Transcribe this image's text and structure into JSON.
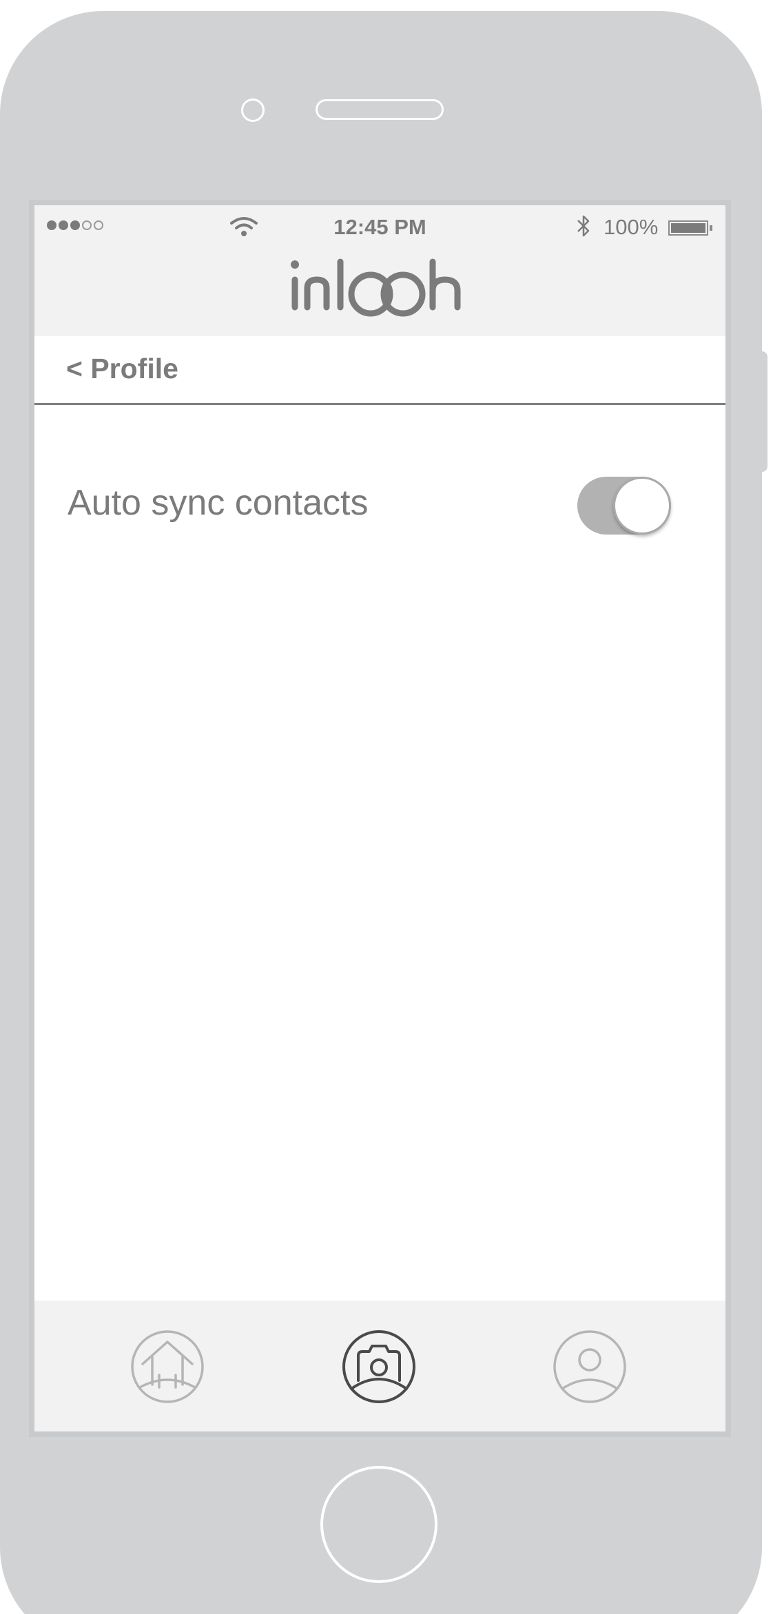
{
  "status_bar": {
    "signal_dots_filled": 3,
    "signal_dots_total": 5,
    "time": "12:45 PM",
    "battery_percent": "100%",
    "icons": [
      "signal-dots-icon",
      "wifi-icon",
      "bluetooth-icon",
      "battery-icon"
    ]
  },
  "header": {
    "logo_text": "inlooh"
  },
  "nav": {
    "back_label": "< Profile"
  },
  "settings": {
    "items": [
      {
        "label": "Auto sync contacts",
        "enabled": true
      }
    ]
  },
  "tab_bar": {
    "items": [
      {
        "icon": "home-icon",
        "active": false
      },
      {
        "icon": "camera-person-icon",
        "active": true
      },
      {
        "icon": "profile-icon",
        "active": false
      }
    ]
  },
  "colors": {
    "device": "#d1d2d4",
    "bars": "#f2f2f2",
    "text": "#7b7b7b",
    "inactive_icon": "#b5b5b5",
    "active_icon": "#4a4a4a",
    "toggle_track": "#b2b2b2"
  }
}
